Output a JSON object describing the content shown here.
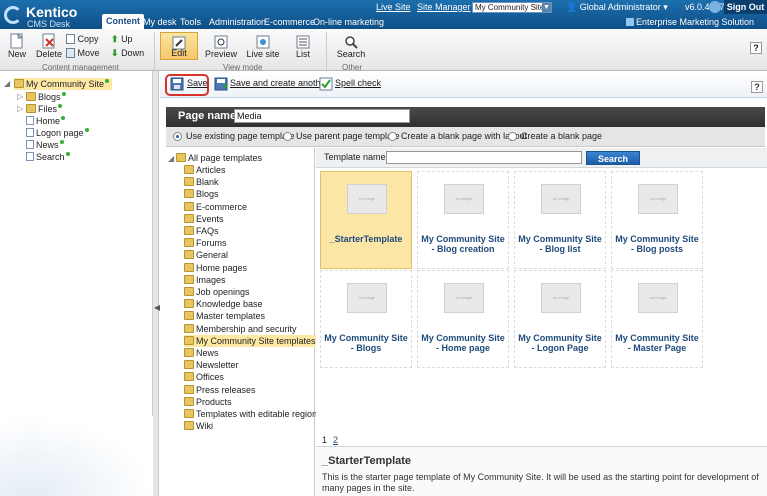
{
  "header": {
    "logo_brand": "Kentico",
    "logo_sub": "CMS Desk",
    "tabs": [
      {
        "label": "Content",
        "active": true
      },
      {
        "label": "My desk",
        "active": false
      },
      {
        "label": "Tools",
        "active": false
      },
      {
        "label": "Administration",
        "active": false
      },
      {
        "label": "E-commerce",
        "active": false
      },
      {
        "label": "On-line marketing",
        "active": false
      }
    ],
    "live_site": "Live Site",
    "site_manager": "Site Manager",
    "site_select": "My Community Site",
    "user": "Global Administrator",
    "version": "v6.0.4237",
    "sign_out": "Sign Out",
    "edition": "Enterprise Marketing Solution"
  },
  "ribbon": {
    "content_management": {
      "label": "Content management",
      "new": "New",
      "delete": "Delete",
      "copy": "Copy",
      "move": "Move",
      "up": "Up",
      "down": "Down"
    },
    "view_mode": {
      "label": "View mode",
      "edit": "Edit",
      "preview": "Preview",
      "live_site": "Live site",
      "list": "List"
    },
    "other": {
      "label": "Other",
      "search": "Search"
    }
  },
  "content_tree": {
    "root": "My Community Site",
    "items": [
      "Blogs",
      "Files",
      "Home",
      "Logon page",
      "News",
      "Search"
    ]
  },
  "toolbar": {
    "save": "Save",
    "save_create": "Save and create another",
    "spell_check": "Spell check",
    "help": "?"
  },
  "page_name": {
    "label": "Page name:",
    "value": "Media"
  },
  "options": [
    {
      "label": "Use existing page template",
      "selected": true
    },
    {
      "label": "Use parent page template",
      "selected": false
    },
    {
      "label": "Create a blank page with layout",
      "selected": false
    },
    {
      "label": "Create a blank page",
      "selected": false
    }
  ],
  "template_tree": {
    "root": "All page templates",
    "items": [
      "Articles",
      "Blank",
      "Blogs",
      "E-commerce",
      "Events",
      "FAQs",
      "Forums",
      "General",
      "Home pages",
      "Images",
      "Job openings",
      "Knowledge base",
      "Master templates",
      "Membership and security",
      "My Community Site templates",
      "News",
      "Newsletter",
      "Offices",
      "Press releases",
      "Products",
      "Templates with editable region",
      "Wiki"
    ],
    "selected": "My Community Site templates"
  },
  "template_search": {
    "label": "Template name:",
    "button": "Search"
  },
  "templates": [
    {
      "title": "_StarterTemplate",
      "selected": true
    },
    {
      "title": "My Community Site - Blog creation",
      "selected": false
    },
    {
      "title": "My Community Site - Blog list",
      "selected": false
    },
    {
      "title": "My Community Site - Blog posts",
      "selected": false
    },
    {
      "title": "My Community Site - Blogs",
      "selected": false
    },
    {
      "title": "My Community Site - Home page",
      "selected": false
    },
    {
      "title": "My Community Site - Logon Page",
      "selected": false
    },
    {
      "title": "My Community Site - Master Page",
      "selected": false
    }
  ],
  "thumb_text": "no image",
  "pager": {
    "current": "1",
    "next": "2"
  },
  "description": {
    "title": "_StarterTemplate",
    "text": "This is the starter page template of My Community Site. It will be used as the starting point for development of many pages in the site."
  }
}
